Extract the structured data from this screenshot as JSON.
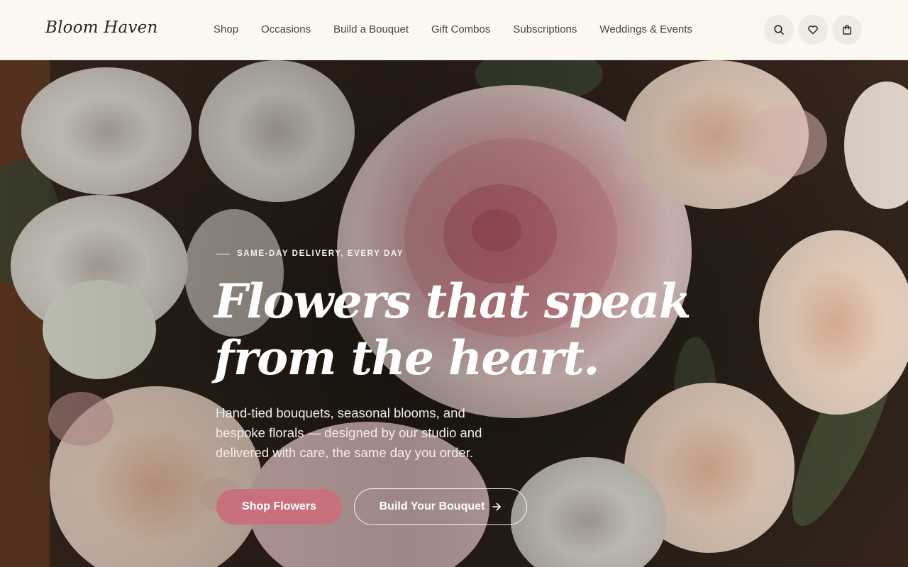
{
  "brand": {
    "name": "Bloom Haven"
  },
  "nav": {
    "items": [
      {
        "label": "Shop"
      },
      {
        "label": "Occasions"
      },
      {
        "label": "Build a Bouquet"
      },
      {
        "label": "Gift Combos"
      },
      {
        "label": "Subscriptions"
      },
      {
        "label": "Weddings & Events"
      }
    ]
  },
  "header_icons": [
    "search-icon",
    "heart-icon",
    "shopping-bag-icon"
  ],
  "hero": {
    "eyebrow": "SAME-DAY DELIVERY, EVERY DAY",
    "headline_line1": "Flowers that speak",
    "headline_line2": "from the heart.",
    "subtext": "Hand-tied bouquets, seasonal blooms, and bespoke florals — designed by our studio and delivered with care, the same day you order.",
    "primary_cta": "Shop Flowers",
    "secondary_cta": "Build Your Bouquet"
  },
  "colors": {
    "header_bg": "#fbf8f2",
    "accent": "#c8707c",
    "text_dark": "#2b2521"
  }
}
